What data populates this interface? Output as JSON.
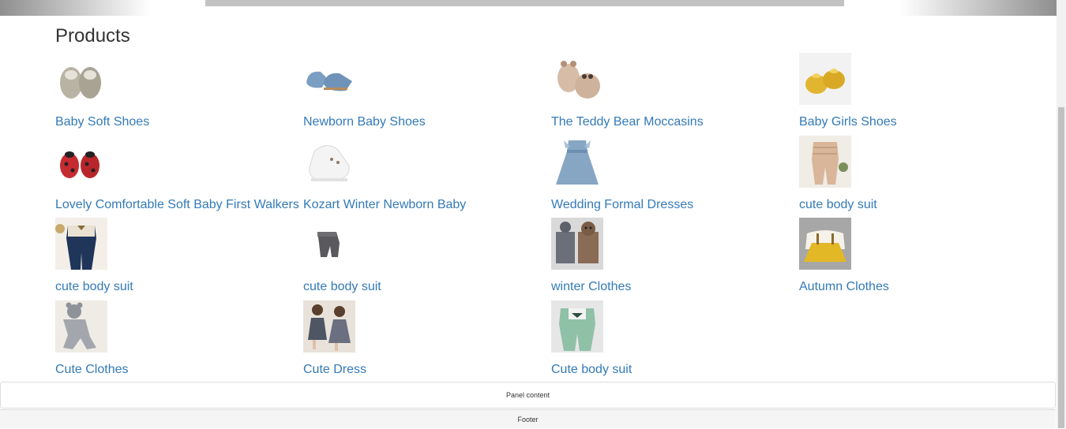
{
  "page_title": "Products",
  "products": [
    {
      "name": "Baby Soft Shoes",
      "icon": "shoe-icon"
    },
    {
      "name": "Newborn Baby Shoes",
      "icon": "shoe-icon"
    },
    {
      "name": "The Teddy Bear Moccasins",
      "icon": "shoe-icon"
    },
    {
      "name": "Baby Girls Shoes",
      "icon": "shoe-icon"
    },
    {
      "name": "Lovely Comfortable Soft Baby First Walkers",
      "icon": "shoe-icon"
    },
    {
      "name": "Kozart Winter Newborn Baby",
      "icon": "shoe-icon"
    },
    {
      "name": "Wedding Formal Dresses",
      "icon": "dress-icon"
    },
    {
      "name": "cute body suit",
      "icon": "bodysuit-icon"
    },
    {
      "name": "cute body suit",
      "icon": "bodysuit-icon"
    },
    {
      "name": "cute body suit",
      "icon": "bodysuit-icon"
    },
    {
      "name": "winter Clothes",
      "icon": "clothes-icon"
    },
    {
      "name": "Autumn Clothes",
      "icon": "clothes-icon"
    },
    {
      "name": "Cute Clothes",
      "icon": "clothes-icon"
    },
    {
      "name": "Cute Dress",
      "icon": "dress-icon"
    },
    {
      "name": "Cute body suit",
      "icon": "bodysuit-icon"
    }
  ],
  "panel": {
    "content": "Panel content"
  },
  "footer": {
    "text": "Footer"
  },
  "colors": {
    "link": "#337ab7",
    "title": "#333333"
  }
}
